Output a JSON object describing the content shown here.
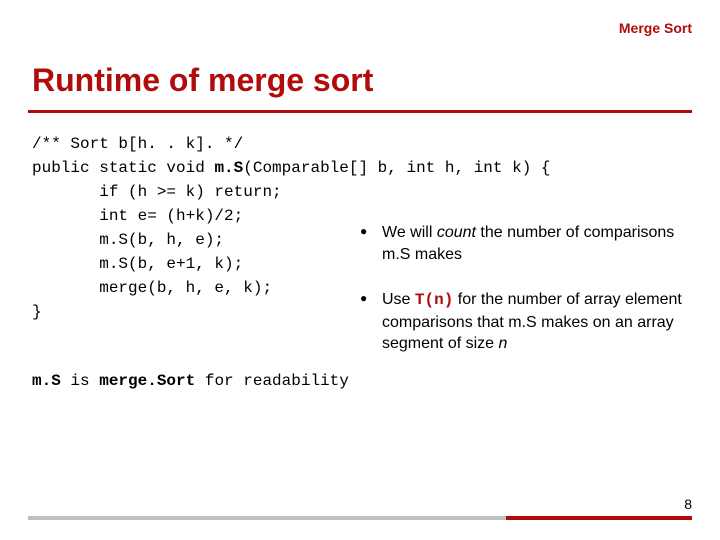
{
  "header": {
    "label": "Merge Sort"
  },
  "title": "Runtime of merge sort",
  "code": {
    "l1": "/** Sort b[h. . k]. */",
    "l2a": "public static void ",
    "l2b": "m.S",
    "l2c": "(Comparable[] b, int h, int k) {",
    "l3": "       if (h >= k) return;",
    "l4": "       int e= (h+k)/2;",
    "l5": "       m.S(b, h, e);",
    "l6": "       m.S(b, e+1, k);",
    "l7": "       merge(b, h, e, k);",
    "l8": "}"
  },
  "bullets": {
    "b1_pre": "We will ",
    "b1_em": "count",
    "b1_post": " the number of comparisons m.S makes",
    "b2_pre": "Use ",
    "b2_tn": "T(n)",
    "b2_mid": " for the number of array element comparisons that m.S makes on an array segment of size ",
    "b2_n": "n"
  },
  "readability": {
    "a": "m.S",
    "b": " is ",
    "c": "merge.Sort",
    "d": " for readability"
  },
  "page": "8"
}
